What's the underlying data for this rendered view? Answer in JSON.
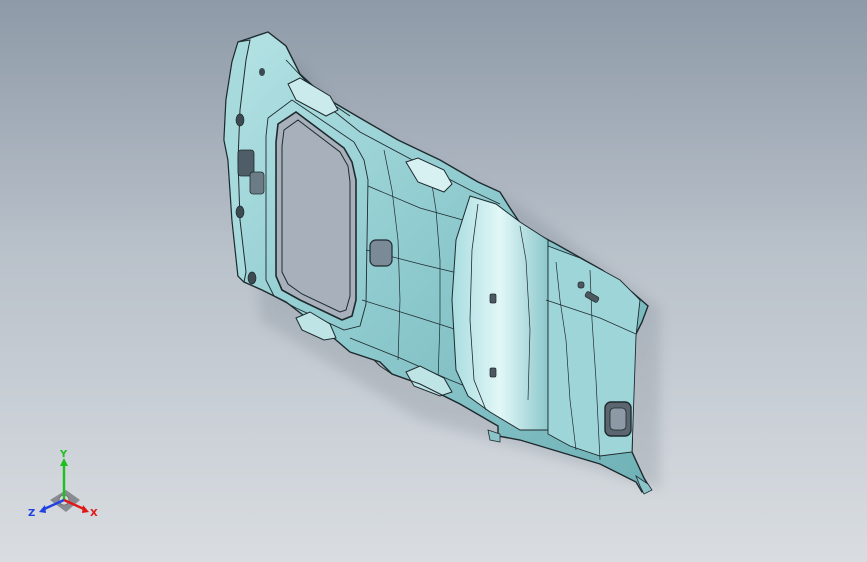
{
  "viewport": {
    "background_top": "#8e9aa8",
    "background_bottom": "#d9dde1"
  },
  "model": {
    "name": "headliner-part",
    "body_color": "#88c6c9",
    "highlight_color": "#cfeef0",
    "shadow_color": "#5f8f94",
    "edge_color": "#1f2a2e"
  },
  "triad": {
    "x_label": "X",
    "y_label": "Y",
    "z_label": "Z",
    "x_color": "#e01818",
    "y_color": "#1fbf1f",
    "z_color": "#2040e0"
  }
}
